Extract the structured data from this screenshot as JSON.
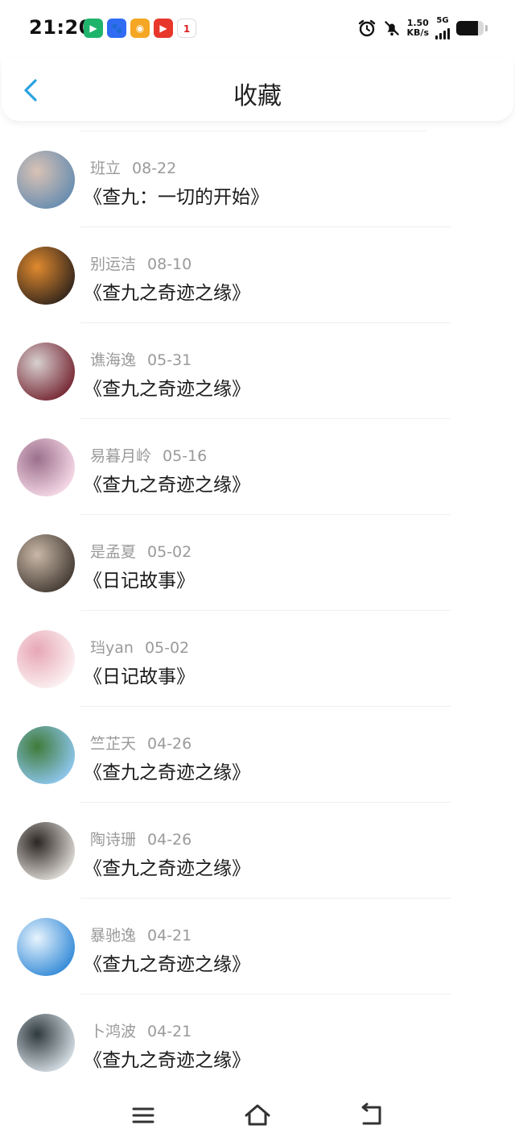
{
  "status_bar": {
    "time": "21:20",
    "net_speed_value": "1.50",
    "net_speed_unit": "KB/s",
    "network_type": "5G",
    "battery_level": 0.8,
    "app_icons": [
      {
        "name": "tencent-video-icon",
        "color": "#1fb46c",
        "glyph": "▶"
      },
      {
        "name": "baidu-icon",
        "color": "#2f6cf3",
        "glyph": "🐾"
      },
      {
        "name": "weibo-icon",
        "color": "#f5a623",
        "glyph": "◉"
      },
      {
        "name": "video-app-icon",
        "color": "#e8372b",
        "glyph": "▶"
      },
      {
        "name": "calendar-icon",
        "color": "#ffffff",
        "glyph": "1"
      }
    ]
  },
  "header": {
    "title": "收藏"
  },
  "items": [
    {
      "user": "班立",
      "date": "08-22",
      "title": "《查九：一切的开始》",
      "avatar_colors": [
        "#6c8fb0",
        "#d9c2b5"
      ]
    },
    {
      "user": "别运洁",
      "date": "08-10",
      "title": "《查九之奇迹之缘》",
      "avatar_colors": [
        "#3b2a1d",
        "#e08a2e"
      ]
    },
    {
      "user": "谯海逸",
      "date": "05-31",
      "title": "《查九之奇迹之缘》",
      "avatar_colors": [
        "#7a2f3a",
        "#d8d0d0"
      ]
    },
    {
      "user": "易暮月岭",
      "date": "05-16",
      "title": "《查九之奇迹之缘》",
      "avatar_colors": [
        "#f3d6e4",
        "#9b6f8c"
      ]
    },
    {
      "user": "是孟夏",
      "date": "05-02",
      "title": "《日记故事》",
      "avatar_colors": [
        "#4a4038",
        "#c9b8a8"
      ]
    },
    {
      "user": "珰yan",
      "date": "05-02",
      "title": "《日记故事》",
      "avatar_colors": [
        "#fbeff1",
        "#e7a7b5"
      ]
    },
    {
      "user": "竺芷天",
      "date": "04-26",
      "title": "《查九之奇迹之缘》",
      "avatar_colors": [
        "#8cc4e8",
        "#3f7b3a"
      ]
    },
    {
      "user": "陶诗珊",
      "date": "04-26",
      "title": "《查九之奇迹之缘》",
      "avatar_colors": [
        "#d8d4d0",
        "#2b2623"
      ]
    },
    {
      "user": "暴驰逸",
      "date": "04-21",
      "title": "《查九之奇迹之缘》",
      "avatar_colors": [
        "#3c8fd9",
        "#e8f4fd"
      ]
    },
    {
      "user": "卜鸿波",
      "date": "04-21",
      "title": "《查九之奇迹之缘》",
      "avatar_colors": [
        "#cfd8de",
        "#2f3a3f"
      ]
    }
  ],
  "nav_bar": {
    "buttons": [
      "menu-icon",
      "home-icon",
      "back-icon"
    ]
  }
}
